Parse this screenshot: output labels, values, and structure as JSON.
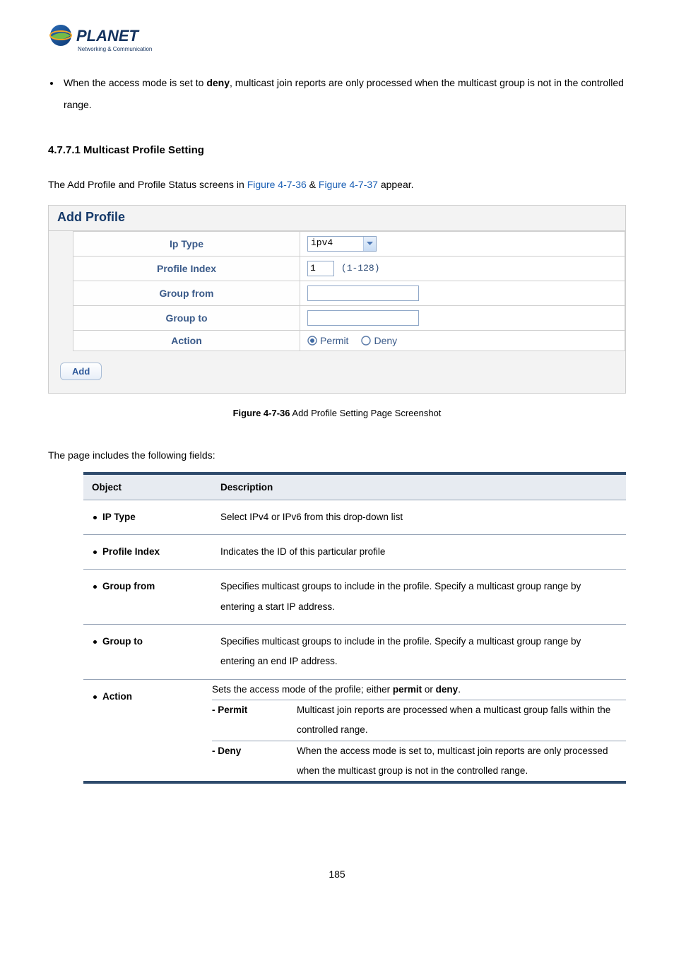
{
  "logo": {
    "brand": "PLANET",
    "tagline": "Networking & Communication"
  },
  "top_bullet": {
    "prefix": "When the access mode is set to ",
    "bold1": "deny",
    "suffix": ", multicast join reports are only processed when the multicast group is not in the controlled range."
  },
  "section_heading": "4.7.7.1 Multicast Profile Setting",
  "intro": {
    "before": "The Add Profile and Profile Status screens in ",
    "link1": "Figure 4-7-36",
    "mid": " & ",
    "link2": "Figure 4-7-37",
    "after": " appear."
  },
  "shot": {
    "title": "Add Profile",
    "rows": {
      "ip_type_label": "Ip Type",
      "ip_type_value": "ipv4",
      "profile_index_label": "Profile Index",
      "profile_index_value": "1",
      "profile_index_range": "(1-128)",
      "group_from_label": "Group from",
      "group_from_value": "",
      "group_to_label": "Group to",
      "group_to_value": "",
      "action_label": "Action",
      "permit_label": "Permit",
      "deny_label": "Deny"
    },
    "add_button": "Add"
  },
  "figure_caption": {
    "bold": "Figure 4-7-36",
    "rest": " Add Profile Setting Page Screenshot"
  },
  "fields_intro": "The page includes the following fields:",
  "desc_table": {
    "h_object": "Object",
    "h_description": "Description",
    "rows": [
      {
        "obj": "IP Type",
        "desc": "Select IPv4 or IPv6 from this drop-down list"
      },
      {
        "obj": "Profile Index",
        "desc": "Indicates the ID of this particular profile"
      },
      {
        "obj": "Group from",
        "desc": "Specifies multicast groups to include in the profile. Specify a multicast group range by entering a start IP address."
      },
      {
        "obj": "Group to",
        "desc": "Specifies multicast groups to include in the profile. Specify a multicast group range by entering an end IP address."
      }
    ],
    "action_row": {
      "obj": "Action",
      "lead_before": "Sets the access mode of the profile; either ",
      "lead_b1": "permit",
      "lead_mid": " or ",
      "lead_b2": "deny",
      "lead_after": ".",
      "permit_label": "- Permit",
      "permit_desc": "Multicast join reports are processed when a multicast group falls within the controlled range.",
      "deny_label": "- Deny",
      "deny_desc": "When the access mode is set to, multicast join reports are only processed when the multicast group is not in the controlled range."
    }
  },
  "page_number": "185"
}
